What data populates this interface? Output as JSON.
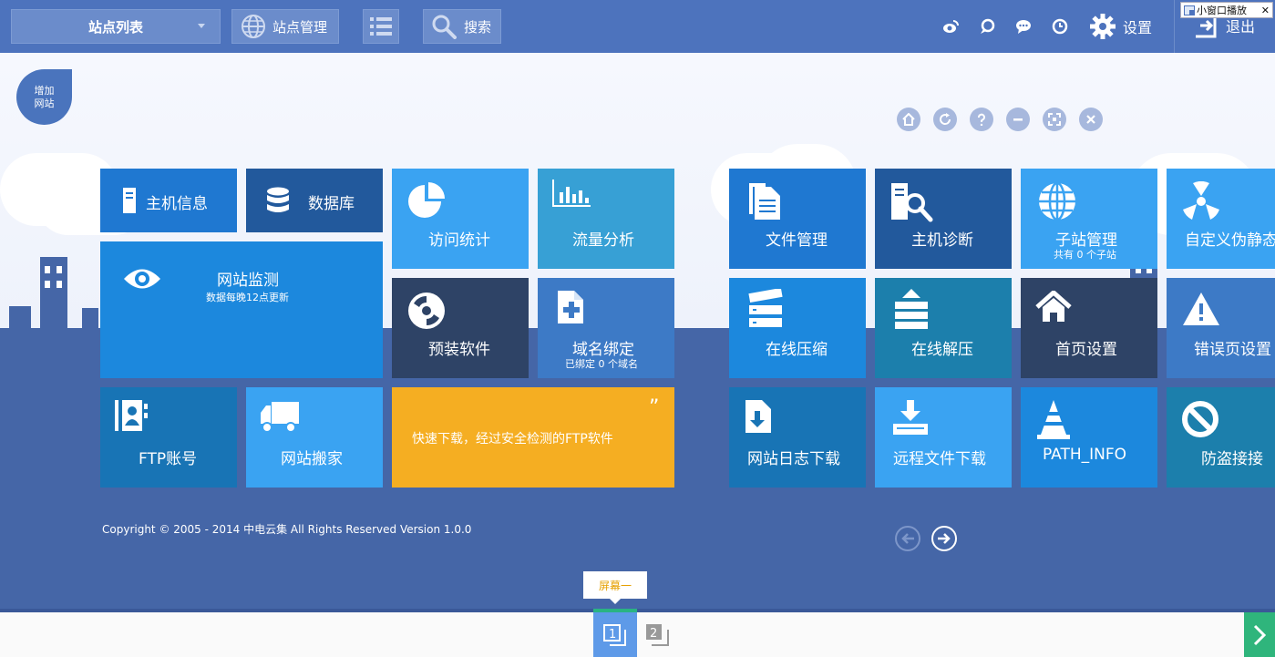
{
  "topbar": {
    "site_list": "站点列表",
    "site_manage": "站点管理",
    "search": "搜索",
    "settings": "设置",
    "logout": "退出",
    "mini_window": "小窗口播放",
    "mini_window_close": "✕",
    "icons": [
      "weibo-icon",
      "chat-bubble-icon",
      "message-icon",
      "clock-icon",
      "gear-icon",
      "logout-icon"
    ]
  },
  "add_site": {
    "line1": "增加",
    "line2": "网站"
  },
  "window_controls": [
    "home-icon",
    "refresh-icon",
    "help-icon",
    "minimize-icon",
    "fullscreen-icon",
    "close-icon"
  ],
  "tiles": {
    "host_info": "主机信息",
    "database": "数据库",
    "visit_stats": "访问统计",
    "traffic": "流量分析",
    "site_monitor": "网站监测",
    "site_monitor_sub": "数据每晚12点更新",
    "preinstall": "预装软件",
    "domain_bind": "域名绑定",
    "domain_bind_sub": "已绑定 0 个域名",
    "ftp": "FTP账号",
    "site_move": "网站搬家",
    "ftp_download": "快速下载，经过安全检测的FTP软件",
    "quote": "”",
    "file_mgr": "文件管理",
    "host_diag": "主机诊断",
    "subsite": "子站管理",
    "subsite_sub": "共有 0 个子站",
    "pseudo_static": "自定义伪静态",
    "compress": "在线压缩",
    "decompress": "在线解压",
    "home_settings": "首页设置",
    "error_page": "错误页设置",
    "log_download": "网站日志下载",
    "remote_download": "远程文件下载",
    "path_info": "PATH_INFO",
    "hotlink": "防盗接接"
  },
  "copyright": "Copyright © 2005 - 2014 中电云集 All Rights Reserved  Version 1.0.0",
  "pager": {
    "tip": "屏幕一",
    "page1": "1",
    "page2": "2"
  },
  "colors": {
    "topbar": "#4d73bd",
    "ground": "#4566a7",
    "tile_blue": "#1f78d1",
    "tile_navy": "#22599c",
    "tile_sky": "#3aa3f2",
    "tile_teal": "#1c7fac",
    "tile_dark": "#2e4366",
    "tile_orange": "#f5ae22",
    "accent_green": "#2fb57c"
  }
}
